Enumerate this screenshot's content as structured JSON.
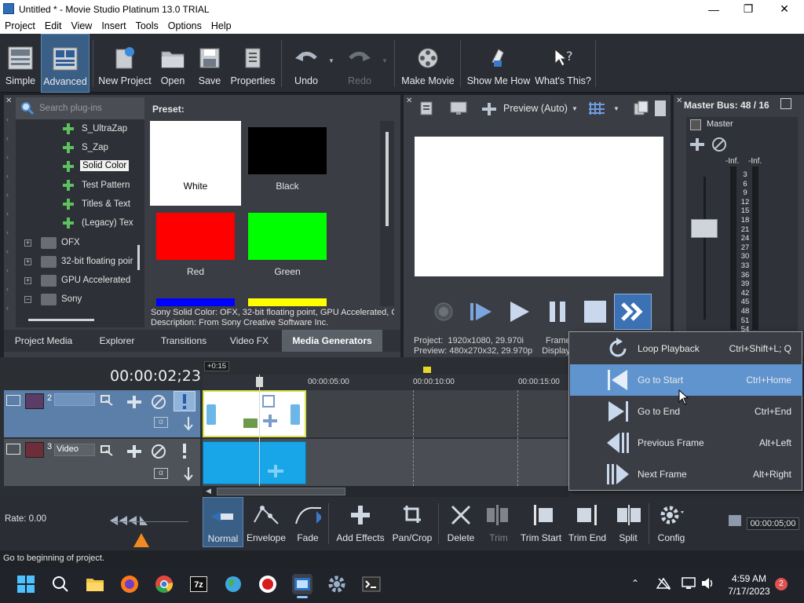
{
  "window": {
    "title": "Untitled * - Movie Studio Platinum 13.0 TRIAL",
    "minimize": "—",
    "maximize": "❐",
    "close": "✕"
  },
  "menu": [
    "Project",
    "Edit",
    "View",
    "Insert",
    "Tools",
    "Options",
    "Help"
  ],
  "toolbar": {
    "simple": "Simple",
    "advanced": "Advanced",
    "new_project": "New Project",
    "open": "Open",
    "save": "Save",
    "properties": "Properties",
    "undo": "Undo",
    "redo": "Redo",
    "make_movie": "Make Movie",
    "show_me_how": "Show Me How",
    "whats_this": "What's This?"
  },
  "plugins": {
    "search_placeholder": "Search plug-ins",
    "tree": [
      {
        "label": "S_UltraZap",
        "type": "plugin"
      },
      {
        "label": "S_Zap",
        "type": "plugin"
      },
      {
        "label": "Solid Color",
        "type": "plugin",
        "selected": true
      },
      {
        "label": "Test Pattern",
        "type": "plugin"
      },
      {
        "label": "Titles & Text",
        "type": "plugin"
      },
      {
        "label": "(Legacy) Tex",
        "type": "plugin"
      },
      {
        "label": "OFX",
        "type": "folder",
        "expander": "+"
      },
      {
        "label": "32-bit floating poir",
        "type": "folder",
        "expander": "+"
      },
      {
        "label": "GPU Accelerated",
        "type": "folder",
        "expander": "+"
      },
      {
        "label": "Sony",
        "type": "folder",
        "expander": "−"
      }
    ],
    "preset_label": "Preset:",
    "presets": [
      {
        "label": "White",
        "color": "#ffffff"
      },
      {
        "label": "Black",
        "color": "#000000"
      },
      {
        "label": "Red",
        "color": "#ff0000"
      },
      {
        "label": "Green",
        "color": "#00ff00"
      },
      {
        "label": "",
        "color": "#0000ff"
      },
      {
        "label": "",
        "color": "#ffff00"
      }
    ],
    "description_line1": "Sony Solid Color: OFX, 32-bit floating point, GPU Accelerated, Gi",
    "description_line2": "Description: From Sony Creative Software Inc."
  },
  "window_tabs": [
    "Project Media",
    "Explorer",
    "Transitions",
    "Video FX",
    "Media Generators"
  ],
  "preview": {
    "mode": "Preview (Auto)",
    "project_label": "Project:",
    "project_value": "1920x1080, 29.970i",
    "preview_label": "Preview:",
    "preview_value": "480x270x32, 29.970p",
    "frame_label": "Frame:",
    "display_label": "Display"
  },
  "master": {
    "title": "Master Bus: 48 / 16",
    "label": "Master",
    "inf_left": "-Inf.",
    "inf_right": "-Inf.",
    "scale": [
      "3",
      "6",
      "9",
      "12",
      "15",
      "18",
      "21",
      "24",
      "27",
      "30",
      "33",
      "36",
      "39",
      "42",
      "45",
      "48",
      "51",
      "54"
    ]
  },
  "timeline": {
    "time": "00:00:02;23",
    "offset_badge": "+0:15",
    "ruler": [
      "00:00:05:00",
      "00:00:10:00",
      "00:00:15:00"
    ],
    "track1_number": "2",
    "track2_number": "3",
    "track2_name": "Video",
    "rate": "Rate: 0.00",
    "end_time": "00:00:05;00"
  },
  "bottom_toolbar": {
    "normal": "Normal",
    "envelope": "Envelope",
    "fade": "Fade",
    "add_effects": "Add Effects",
    "pan_crop": "Pan/Crop",
    "delete": "Delete",
    "trim": "Trim",
    "trim_start": "Trim Start",
    "trim_end": "Trim End",
    "split": "Split",
    "config": "Config"
  },
  "status": "Go to beginning of project.",
  "transport_menu": [
    {
      "label": "Loop Playback",
      "shortcut": "Ctrl+Shift+L; Q",
      "icon": "loop-icon"
    },
    {
      "label": "Go to Start",
      "shortcut": "Ctrl+Home",
      "icon": "go-to-start-icon",
      "highlighted": true
    },
    {
      "label": "Go to End",
      "shortcut": "Ctrl+End",
      "icon": "go-to-end-icon"
    },
    {
      "label": "Previous Frame",
      "shortcut": "Alt+Left",
      "icon": "previous-frame-icon"
    },
    {
      "label": "Next Frame",
      "shortcut": "Alt+Right",
      "icon": "next-frame-icon"
    }
  ],
  "taskbar": {
    "time": "4:59 AM",
    "date": "7/17/2023",
    "notifications": "2"
  },
  "colors": {
    "accent": "#5f94cf",
    "toolbar_bg": "#2a2d33",
    "track_active": "#5b7fa8",
    "clip_video": "#18a6e8",
    "clip_border": "#d8e34a"
  }
}
